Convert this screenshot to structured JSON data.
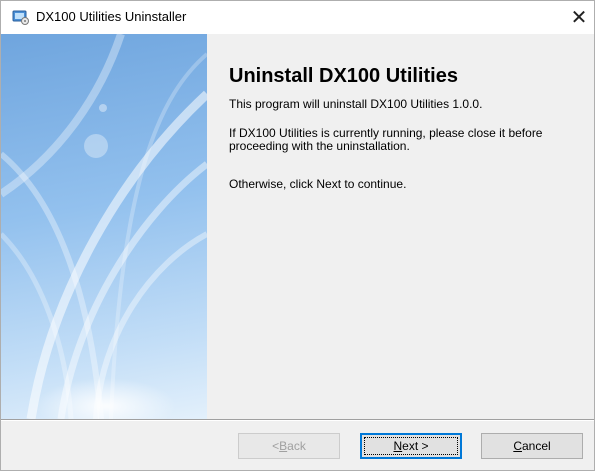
{
  "window": {
    "title": "DX100 Utilities Uninstaller",
    "close_glyph": "✕"
  },
  "content": {
    "heading": "Uninstall DX100 Utilities",
    "paragraph1": "This program will uninstall DX100 Utilities 1.0.0.",
    "paragraph2": "If DX100 Utilities is currently running, please close it before proceeding with the uninstallation.",
    "paragraph3": "Otherwise, click Next to continue."
  },
  "buttons": {
    "back": {
      "accel": "B",
      "rest": "ack",
      "prefix": "< ",
      "enabled": false
    },
    "next": {
      "accel": "N",
      "rest": "ext >",
      "enabled": true,
      "focused": true
    },
    "cancel": {
      "accel": "C",
      "rest": "ancel",
      "enabled": true
    }
  },
  "icons": {
    "app": "installer-app-icon",
    "close": "close-icon"
  },
  "colors": {
    "banner_top": "#6fa5de",
    "banner_bottom": "#e3f0fb",
    "dialog_background": "#f0f0f0",
    "focus_border": "#0078d7"
  }
}
